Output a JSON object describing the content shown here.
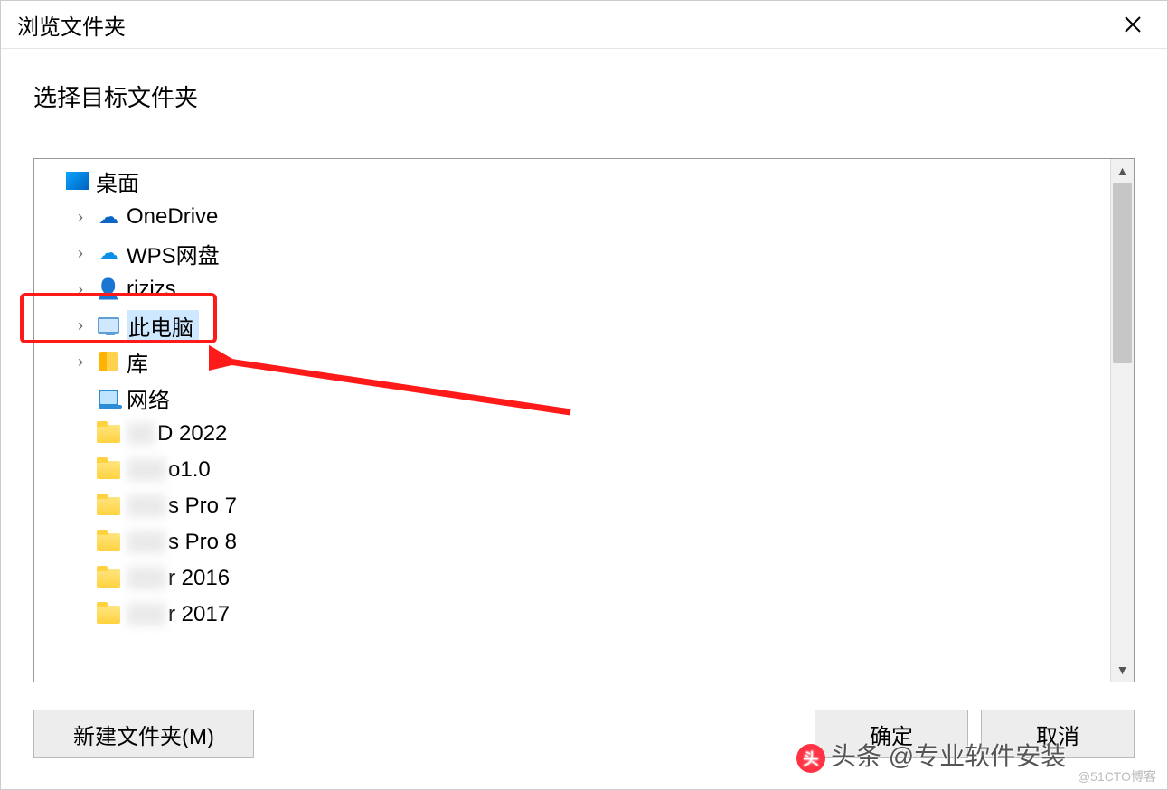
{
  "dialog": {
    "title": "浏览文件夹",
    "instruction": "选择目标文件夹"
  },
  "tree": {
    "items": [
      {
        "label": "桌面",
        "icon": "desktop",
        "expander": "none",
        "indent": 1,
        "blur": ""
      },
      {
        "label": "OneDrive",
        "icon": "onedrive",
        "expander": "collapsed",
        "indent": 2,
        "blur": ""
      },
      {
        "label": "WPS网盘",
        "icon": "wpscloud",
        "expander": "collapsed",
        "indent": 2,
        "blur": ""
      },
      {
        "label": "rizizs",
        "icon": "user",
        "expander": "collapsed",
        "indent": 2,
        "blur": ""
      },
      {
        "label": "此电脑",
        "icon": "pc",
        "expander": "collapsed",
        "indent": 2,
        "blur": "",
        "selected": true
      },
      {
        "label": "库",
        "icon": "library",
        "expander": "collapsed",
        "indent": 2,
        "blur": ""
      },
      {
        "label": "网络",
        "icon": "network",
        "expander": "none",
        "indent": 2,
        "blur": ""
      },
      {
        "label": "D 2022",
        "icon": "folder",
        "expander": "none",
        "indent": 2,
        "blur": "xx"
      },
      {
        "label": "o1.0",
        "icon": "folder",
        "expander": "none",
        "indent": 2,
        "blur": "xxx"
      },
      {
        "label": "s Pro 7",
        "icon": "folder",
        "expander": "none",
        "indent": 2,
        "blur": "xxx"
      },
      {
        "label": "s Pro 8",
        "icon": "folder",
        "expander": "none",
        "indent": 2,
        "blur": "xxx"
      },
      {
        "label": "r 2016",
        "icon": "folder",
        "expander": "none",
        "indent": 2,
        "blur": "xxx"
      },
      {
        "label": "r 2017",
        "icon": "folder",
        "expander": "none",
        "indent": 2,
        "blur": "xxx"
      }
    ]
  },
  "buttons": {
    "new_folder": "新建文件夹(M)",
    "ok": "确定",
    "cancel": "取消"
  },
  "watermark": {
    "top": "头条 @专业软件安装",
    "bottom": "@51CTO博客"
  }
}
